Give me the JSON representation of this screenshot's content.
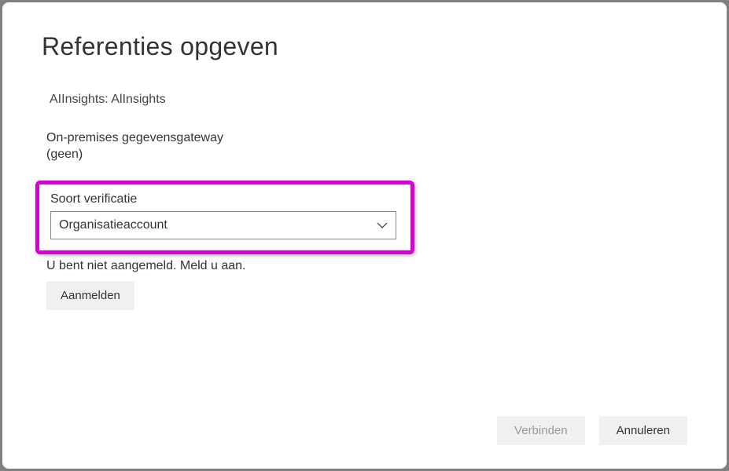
{
  "dialog": {
    "title": "Referenties opgeven",
    "source_label": "AIInsights: AlInsights",
    "gateway_label": "On-premises gegevensgateway",
    "gateway_value": "(geen)",
    "auth": {
      "label": "Soort verificatie",
      "selected": "Organisatieaccount"
    },
    "signin_text": "U bent niet aangemeld. Meld u aan.",
    "signin_button": "Aanmelden",
    "connect_button": "Verbinden",
    "cancel_button": "Annuleren"
  }
}
